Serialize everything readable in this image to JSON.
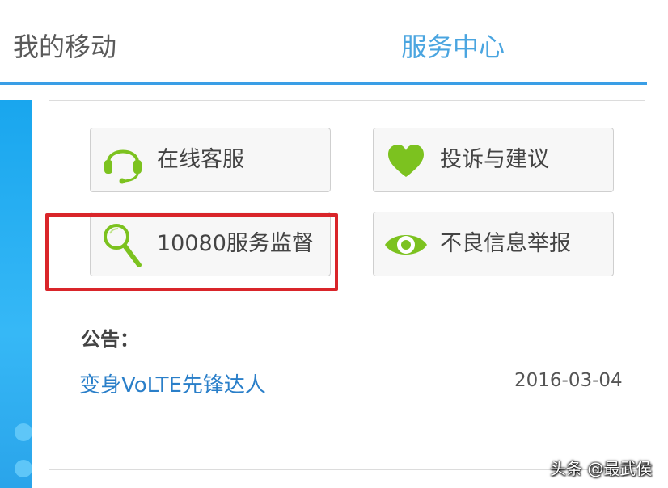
{
  "tabs": {
    "mine": "我的移动",
    "service": "服务中心"
  },
  "services": {
    "online": {
      "label": "在线客服",
      "icon": "headset-icon"
    },
    "complaint": {
      "label": "投诉与建议",
      "icon": "heart-icon"
    },
    "supervise": {
      "label": "10080服务监督",
      "icon": "magnifier-icon"
    },
    "report": {
      "label": "不良信息举报",
      "icon": "eye-icon"
    }
  },
  "notice": {
    "title": "公告：",
    "items": [
      {
        "text": "变身VoLTE先锋达人",
        "date": "2016-03-04"
      }
    ]
  },
  "watermark": "头条 @最武侯",
  "colors": {
    "accent_blue": "#3a9ee6",
    "icon_green": "#7cc21f",
    "highlight_red": "#d9252a",
    "link_blue": "#2a7fc9"
  }
}
